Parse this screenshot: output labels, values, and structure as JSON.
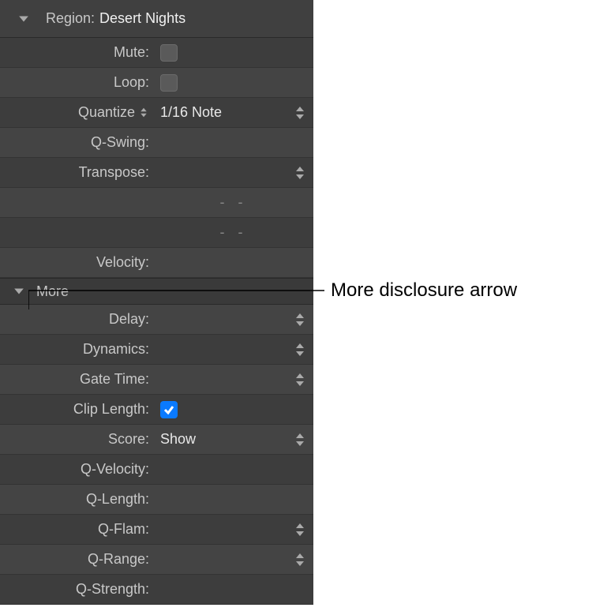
{
  "header": {
    "label": "Region:",
    "title": "Desert Nights"
  },
  "section_more": "More",
  "rows": {
    "mute": {
      "label": "Mute:"
    },
    "loop": {
      "label": "Loop:"
    },
    "quantize": {
      "label": "Quantize",
      "value": "1/16 Note"
    },
    "qswing": {
      "label": "Q-Swing:"
    },
    "transpose": {
      "label": "Transpose:"
    },
    "blank1": {
      "value": "-  -"
    },
    "blank2": {
      "value": "-  -"
    },
    "velocity": {
      "label": "Velocity:"
    },
    "delay": {
      "label": "Delay:"
    },
    "dynamics": {
      "label": "Dynamics:"
    },
    "gatetime": {
      "label": "Gate Time:"
    },
    "cliplength": {
      "label": "Clip Length:"
    },
    "score": {
      "label": "Score:",
      "value": "Show"
    },
    "qvelocity": {
      "label": "Q-Velocity:"
    },
    "qlength": {
      "label": "Q-Length:"
    },
    "qflam": {
      "label": "Q-Flam:"
    },
    "qrange": {
      "label": "Q-Range:"
    },
    "qstrength": {
      "label": "Q-Strength:"
    }
  },
  "annotation": "More disclosure arrow"
}
